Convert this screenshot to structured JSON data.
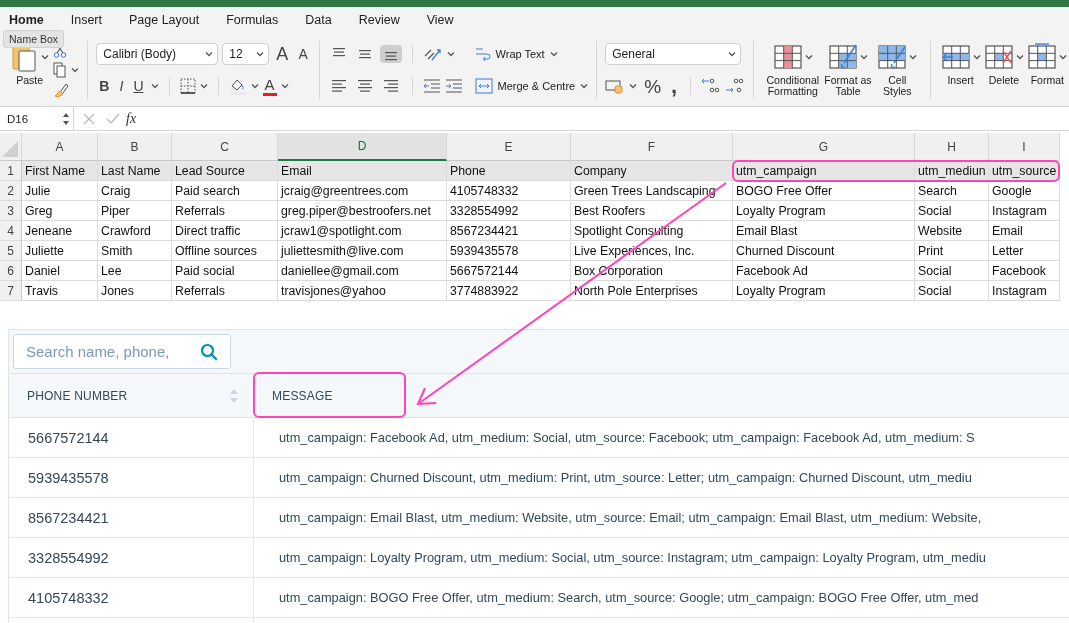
{
  "ribbon": {
    "tabs": [
      {
        "label": "Home",
        "selected": true
      },
      {
        "label": "Insert",
        "selected": false
      },
      {
        "label": "Page Layout",
        "selected": false
      },
      {
        "label": "Formulas",
        "selected": false
      },
      {
        "label": "Data",
        "selected": false
      },
      {
        "label": "Review",
        "selected": false
      },
      {
        "label": "View",
        "selected": false
      }
    ],
    "tooltip": "Name Box",
    "paste": "Paste",
    "font": {
      "name": "Calibri (Body)",
      "size": "12",
      "grow": "A",
      "shrink": "A",
      "bold": "B",
      "italic": "I",
      "underline": "U",
      "font_colour_glyph": "A"
    },
    "vertical_align": [
      {
        "selected": false
      },
      {
        "selected": false
      },
      {
        "selected": true
      }
    ],
    "wrap_text": "Wrap Text",
    "merge": "Merge & Centre",
    "number_format": "General",
    "percent": "%",
    "comma": ",",
    "styles": [
      {
        "label": "Conditional Formatting"
      },
      {
        "label": "Format as Table"
      },
      {
        "label": "Cell Styles"
      }
    ],
    "cells": [
      {
        "label": "Insert"
      },
      {
        "label": "Delete"
      },
      {
        "label": "Format"
      }
    ]
  },
  "formula_bar": {
    "name_box": "D16",
    "fx": "fx"
  },
  "sheet": {
    "columns": [
      {
        "label": "A",
        "selected": false
      },
      {
        "label": "B",
        "selected": false
      },
      {
        "label": "C",
        "selected": false
      },
      {
        "label": "D",
        "selected": true
      },
      {
        "label": "E",
        "selected": false
      },
      {
        "label": "F",
        "selected": false
      },
      {
        "label": "G",
        "selected": false
      },
      {
        "label": "H",
        "selected": false
      },
      {
        "label": "I",
        "selected": false
      }
    ],
    "rows": [
      {
        "number": "1",
        "header": true,
        "cells": [
          "First Name",
          "Last Name",
          "Lead Source",
          "Email",
          "Phone",
          "Company",
          "utm_campaign",
          "utm_mediun",
          "utm_source"
        ]
      },
      {
        "number": "2",
        "header": false,
        "cells": [
          "Julie",
          "Craig",
          "Paid search",
          "jcraig@greentrees.com",
          "4105748332",
          "Green Trees Landscaping",
          "BOGO Free Offer",
          "Search",
          "Google"
        ]
      },
      {
        "number": "3",
        "header": false,
        "cells": [
          "Greg",
          "Piper",
          "Referrals",
          "greg.piper@bestroofers.net",
          "3328554992",
          "Best Roofers",
          "Loyalty Program",
          "Social",
          "Instagram"
        ]
      },
      {
        "number": "4",
        "header": false,
        "cells": [
          "Jeneane",
          "Crawford",
          "Direct traffic",
          "jcraw1@spotlight.com",
          "8567234421",
          "Spotlight Consulting",
          "Email Blast",
          "Website",
          "Email"
        ]
      },
      {
        "number": "5",
        "header": false,
        "cells": [
          "Juliette",
          "Smith",
          "Offline sources",
          "juliettesmith@live.com",
          "5939435578",
          "Live Experiences, Inc.",
          "Churned Discount",
          "Print",
          "Letter"
        ]
      },
      {
        "number": "6",
        "header": false,
        "cells": [
          "Daniel",
          "Lee",
          "Paid social",
          "daniellee@gmail.com",
          "5667572144",
          "Box Corporation",
          "Facebook Ad",
          "Social",
          "Facebook"
        ]
      },
      {
        "number": "7",
        "header": false,
        "cells": [
          "Travis",
          "Jones",
          "Referrals",
          "travisjones@yahoo",
          "3774883922",
          "North Pole Enterprises",
          "Loyalty Program",
          "Social",
          "Instagram"
        ]
      }
    ]
  },
  "contacts_panel": {
    "search": {
      "placeholder": "Search name, phone,"
    },
    "columns": [
      {
        "label": "PHONE NUMBER",
        "sortable": true
      },
      {
        "label": "MESSAGE",
        "sortable": false
      }
    ],
    "rows": [
      {
        "phone": "5667572144",
        "message": "utm_campaign: Facebook Ad, utm_medium: Social, utm_source: Facebook; utm_campaign: Facebook Ad, utm_medium: S"
      },
      {
        "phone": "5939435578",
        "message": "utm_campaign: Churned Discount, utm_medium: Print, utm_source: Letter; utm_campaign: Churned Discount, utm_mediu"
      },
      {
        "phone": "8567234421",
        "message": "utm_campaign: Email Blast, utm_medium: Website, utm_source: Email; utm_campaign: Email Blast, utm_medium: Website,"
      },
      {
        "phone": "3328554992",
        "message": "utm_campaign: Loyalty Program, utm_medium: Social, utm_source: Instagram; utm_campaign: Loyalty Program, utm_mediu"
      },
      {
        "phone": "4105748332",
        "message": "utm_campaign: BOGO Free Offer, utm_medium: Search, utm_source: Google; utm_campaign: BOGO Free Offer, utm_med"
      }
    ]
  }
}
